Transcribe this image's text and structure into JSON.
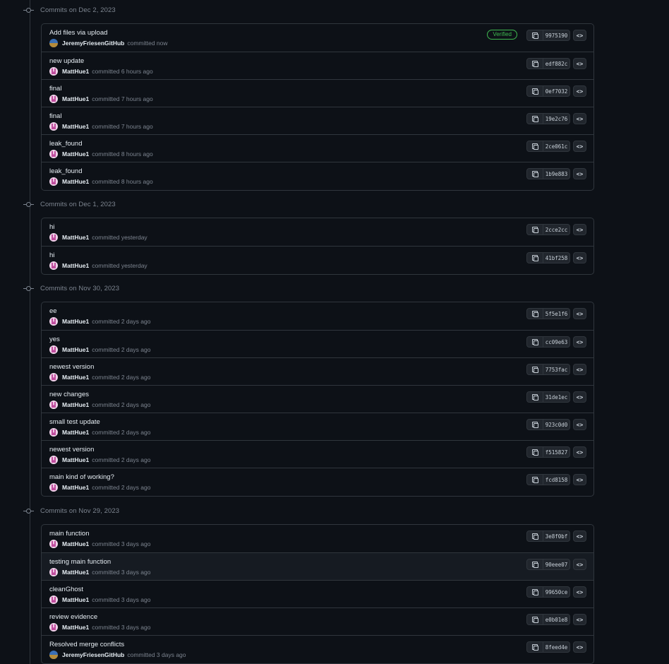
{
  "groups": [
    {
      "title": "Commits on Dec 2, 2023",
      "commits": [
        {
          "message": "Add files via upload",
          "author": "JeremyFriesenGitHub",
          "time": "committed now",
          "sha": "9975190",
          "verified": "Verified",
          "avatar": "blue"
        },
        {
          "message": "new update",
          "author": "MattHue1",
          "time": "committed 6 hours ago",
          "sha": "edf882c",
          "avatar": "pink"
        },
        {
          "message": "final",
          "author": "MattHue1",
          "time": "committed 7 hours ago",
          "sha": "0ef7032",
          "avatar": "pink"
        },
        {
          "message": "final",
          "author": "MattHue1",
          "time": "committed 7 hours ago",
          "sha": "19e2c76",
          "avatar": "pink"
        },
        {
          "message": "leak_found",
          "author": "MattHue1",
          "time": "committed 8 hours ago",
          "sha": "2ce061c",
          "avatar": "pink"
        },
        {
          "message": "leak_found",
          "author": "MattHue1",
          "time": "committed 8 hours ago",
          "sha": "1b9e883",
          "avatar": "pink"
        }
      ]
    },
    {
      "title": "Commits on Dec 1, 2023",
      "commits": [
        {
          "message": "hi",
          "author": "MattHue1",
          "time": "committed yesterday",
          "sha": "2cce2cc",
          "avatar": "pink"
        },
        {
          "message": "hi",
          "author": "MattHue1",
          "time": "committed yesterday",
          "sha": "41bf258",
          "avatar": "pink"
        }
      ]
    },
    {
      "title": "Commits on Nov 30, 2023",
      "commits": [
        {
          "message": "ee",
          "author": "MattHue1",
          "time": "committed 2 days ago",
          "sha": "5f5e1f6",
          "avatar": "pink"
        },
        {
          "message": "yes",
          "author": "MattHue1",
          "time": "committed 2 days ago",
          "sha": "cc09e63",
          "avatar": "pink"
        },
        {
          "message": "newest version",
          "author": "MattHue1",
          "time": "committed 2 days ago",
          "sha": "7753fac",
          "avatar": "pink"
        },
        {
          "message": "new changes",
          "author": "MattHue1",
          "time": "committed 2 days ago",
          "sha": "31de1ec",
          "avatar": "pink"
        },
        {
          "message": "small test update",
          "author": "MattHue1",
          "time": "committed 2 days ago",
          "sha": "923c0d0",
          "avatar": "pink"
        },
        {
          "message": "newest version",
          "author": "MattHue1",
          "time": "committed 2 days ago",
          "sha": "f515827",
          "avatar": "pink"
        },
        {
          "message": "main kind of working?",
          "author": "MattHue1",
          "time": "committed 2 days ago",
          "sha": "fcd8158",
          "avatar": "pink"
        }
      ]
    },
    {
      "title": "Commits on Nov 29, 2023",
      "commits": [
        {
          "message": "main function",
          "author": "MattHue1",
          "time": "committed 3 days ago",
          "sha": "3e8f0bf",
          "avatar": "pink"
        },
        {
          "message": "testing main function",
          "author": "MattHue1",
          "time": "committed 3 days ago",
          "sha": "90eee07",
          "avatar": "pink",
          "highlight": true
        },
        {
          "message": "cleanGhost",
          "author": "MattHue1",
          "time": "committed 3 days ago",
          "sha": "99650ce",
          "avatar": "pink"
        },
        {
          "message": "review evidence",
          "author": "MattHue1",
          "time": "committed 3 days ago",
          "sha": "e0b01e8",
          "avatar": "pink"
        },
        {
          "message": "Resolved merge conflicts",
          "author": "JeremyFriesenGitHub",
          "time": "committed 3 days ago",
          "sha": "8feed4e",
          "avatar": "blue"
        }
      ]
    }
  ],
  "colors": {
    "background": "#0d1117",
    "border": "#30363d",
    "muted_text": "#7d8590",
    "verified_green": "#3fb950",
    "button_bg": "#21262d"
  },
  "icons": {
    "copy": "copy-icon",
    "browse": "code-brackets-icon",
    "timeline": "commit-node-icon"
  }
}
